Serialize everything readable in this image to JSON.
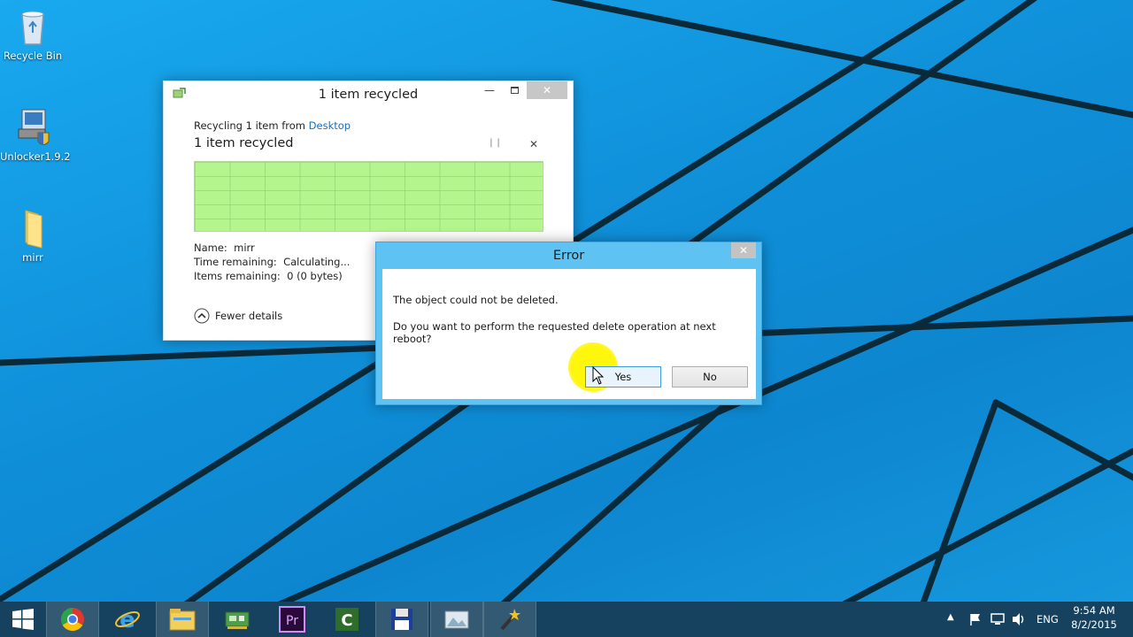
{
  "desktop": {
    "icons": [
      {
        "label": "Recycle Bin",
        "icon": "recycle-bin-icon"
      },
      {
        "label": "Unlocker1.9.2",
        "icon": "installer-icon"
      },
      {
        "label": "mirr",
        "icon": "folder-icon"
      }
    ]
  },
  "copy_window": {
    "title": "1 item recycled",
    "recycling_prefix": "Recycling 1 item from ",
    "source_link": "Desktop",
    "status_heading": "1 item recycled",
    "progress_percent": 100,
    "progress_color": "#b4f58d",
    "name_label": "Name:",
    "name_value": "mirr",
    "time_label": "Time remaining:",
    "time_value": "Calculating...",
    "items_label": "Items remaining:",
    "items_value": "0 (0 bytes)",
    "fewer_details": "Fewer details"
  },
  "error_dialog": {
    "title": "Error",
    "message": "The object could not be deleted.",
    "question": "Do you want to perform the requested delete operation at next reboot?",
    "yes_label": "Yes",
    "no_label": "No"
  },
  "taskbar": {
    "apps": [
      "start",
      "chrome",
      "internet-explorer",
      "file-explorer",
      "network-app",
      "premiere",
      "camtasia",
      "save-app",
      "image-app",
      "wizard-app"
    ],
    "language": "ENG",
    "time": "9:54 AM",
    "date": "8/2/2015"
  },
  "colors": {
    "desktop_blue": "#1aa3e8",
    "taskbar": "#16425f",
    "error_frame": "#5ec3f2"
  }
}
